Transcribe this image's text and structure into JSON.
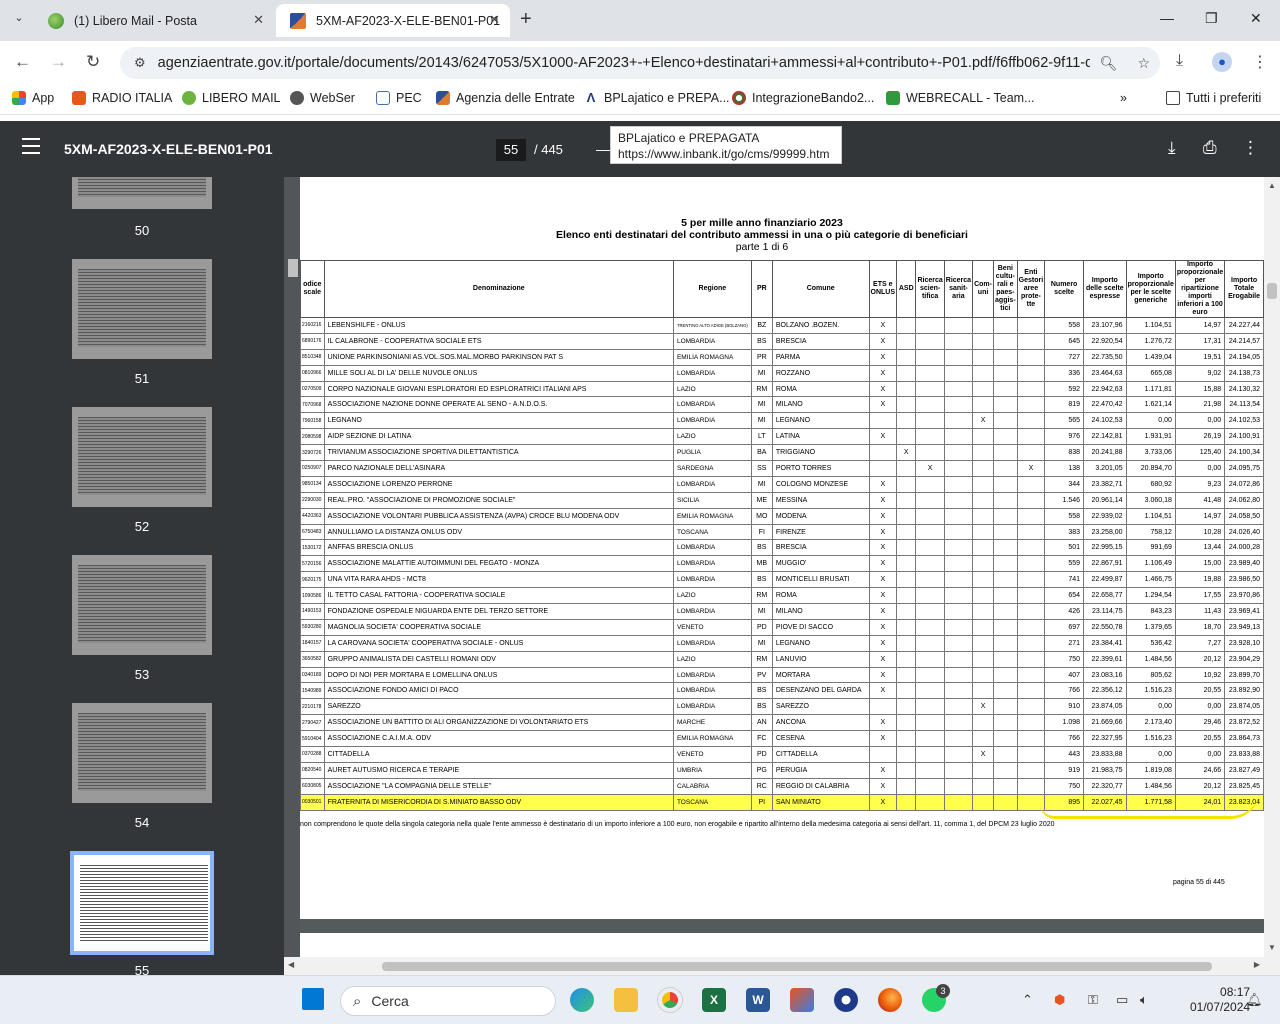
{
  "tabs": [
    {
      "label": "(1) Libero Mail - Posta"
    },
    {
      "label": "5XM-AF2023-X-ELE-BEN01-P01"
    }
  ],
  "url": "agenziaentrate.gov.it/portale/documents/20143/6247053/5X1000-AF2023+-+Elenco+destinatari+ammessi+al+contributo+-P01.pdf/f6ffb062-9f11-d...",
  "bookmarks": [
    {
      "label": "App"
    },
    {
      "label": "RADIO ITALIA"
    },
    {
      "label": "LIBERO MAIL"
    },
    {
      "label": "WebSer"
    },
    {
      "label": "PEC"
    },
    {
      "label": "Agenzia delle Entrate"
    },
    {
      "label": "BPLajatico e PREPA..."
    },
    {
      "label": "IntegrazioneBando2..."
    },
    {
      "label": "WEBRECALL - Team..."
    },
    {
      "label": "Tutti i preferiti"
    }
  ],
  "tooltip": {
    "title": "BPLajatico e PREPAGATA",
    "url": "https://www.inbank.it/go/cms/99999.htm"
  },
  "pdf": {
    "title": "5XM-AF2023-X-ELE-BEN01-P01",
    "page": "55",
    "total": "/ 445"
  },
  "thumbs": [
    "50",
    "51",
    "52",
    "53",
    "54",
    "55"
  ],
  "doc": {
    "title1": "5 per mille anno finanziario 2023",
    "title2": "Elenco enti destinatari del contributo ammessi in una o più categorie di beneficiari",
    "part": "parte 1 di 6",
    "headers": [
      "odice scale",
      "Denominazione",
      "Regione",
      "PR",
      "Comune",
      "ETS e ONLUS",
      "ASD",
      "Ricerca scien-tifica",
      "Ricerca sanit-aria",
      "Com-uni",
      "Beni cultu-rali e paes-aggis-tici",
      "Enti Gestori aree prote-tte",
      "Numero scelte",
      "Importo delle scelte espresse",
      "Importo proporzionale per le scelte generiche",
      "Importo proporzionale per ripartizione importi inferiori a 100 euro",
      "Importo Totale Erogabile"
    ],
    "rows": [
      [
        "2160216",
        "LEBENSHILFE - ONLUS",
        "TRENTINO ALTO ADIGE (BOLZANO)",
        "BZ",
        "BOLZANO .BOZEN.",
        "X",
        "",
        "",
        "",
        "",
        "",
        "",
        "558",
        "23.107,96",
        "1.104,51",
        "14,97",
        "24.227,44"
      ],
      [
        "6890176",
        "IL CALABRONE - COOPERATIVA SOCIALE ETS",
        "LOMBARDIA",
        "BS",
        "BRESCIA",
        "X",
        "",
        "",
        "",
        "",
        "",
        "",
        "645",
        "22.920,54",
        "1.276,72",
        "17,31",
        "24.214,57"
      ],
      [
        "8510348",
        "UNIONE PARKINSONIANI AS.VOL.SOS.MAL.MORBO PARKINSON PAT S",
        "EMILIA ROMAGNA",
        "PR",
        "PARMA",
        "X",
        "",
        "",
        "",
        "",
        "",
        "",
        "727",
        "22.735,50",
        "1.439,04",
        "19,51",
        "24.194,05"
      ],
      [
        "0810966",
        "MILLE SOLI AL DI LA' DELLE NUVOLE ONLUS",
        "LOMBARDIA",
        "MI",
        "ROZZANO",
        "X",
        "",
        "",
        "",
        "",
        "",
        "",
        "336",
        "23.464,63",
        "665,08",
        "9,02",
        "24.138,73"
      ],
      [
        "0270509",
        "CORPO NAZIONALE GIOVANI ESPLORATORI ED ESPLORATRICI ITALIANI APS",
        "LAZIO",
        "RM",
        "ROMA",
        "X",
        "",
        "",
        "",
        "",
        "",
        "",
        "592",
        "22.942,63",
        "1.171,81",
        "15,88",
        "24.130,32"
      ],
      [
        "7070968",
        "ASSOCIAZIONE NAZIONE DONNE OPERATE AL SENO - A.N.D.O.S.",
        "LOMBARDIA",
        "MI",
        "MILANO",
        "X",
        "",
        "",
        "",
        "",
        "",
        "",
        "819",
        "22.470,42",
        "1.621,14",
        "21,98",
        "24.113,54"
      ],
      [
        "7960158",
        "LEGNANO",
        "LOMBARDIA",
        "MI",
        "LEGNANO",
        "",
        "",
        "",
        "",
        "X",
        "",
        "",
        "565",
        "24.102,53",
        "0,00",
        "0,00",
        "24.102,53"
      ],
      [
        "2080598",
        "AIDP SEZIONE DI LATINA",
        "LAZIO",
        "LT",
        "LATINA",
        "X",
        "",
        "",
        "",
        "",
        "",
        "",
        "976",
        "22.142,81",
        "1.931,91",
        "26,19",
        "24.100,91"
      ],
      [
        "3290726",
        "TRIVIANUM ASSOCIAZIONE SPORTIVA DILETTANTISTICA",
        "PUGLIA",
        "BA",
        "TRIGGIANO",
        "",
        "X",
        "",
        "",
        "",
        "",
        "",
        "838",
        "20.241,88",
        "3.733,06",
        "125,40",
        "24.100,34"
      ],
      [
        "0250907",
        "PARCO NAZIONALE DELL'ASINARA",
        "SARDEGNA",
        "SS",
        "PORTO TORRES",
        "",
        "",
        "X",
        "",
        "",
        "",
        "X",
        "138",
        "3.201,05",
        "20.894,70",
        "0,00",
        "24.095,75"
      ],
      [
        "9850134",
        "ASSOCIAZIONE LORENZO PERRONE",
        "LOMBARDIA",
        "MI",
        "COLOGNO MONZESE",
        "X",
        "",
        "",
        "",
        "",
        "",
        "",
        "344",
        "23.382,71",
        "680,92",
        "9,23",
        "24.072,86"
      ],
      [
        "2290030",
        "REAL.PRO. \"ASSOCIAZIONE DI PROMOZIONE SOCIALE\"",
        "SICILIA",
        "ME",
        "MESSINA",
        "X",
        "",
        "",
        "",
        "",
        "",
        "",
        "1.546",
        "20.961,14",
        "3.060,18",
        "41,48",
        "24.062,80"
      ],
      [
        "4420363",
        "ASSOCIAZIONE VOLONTARI PUBBLICA ASSISTENZA (AVPA) CROCE BLU MODENA ODV",
        "EMILIA ROMAGNA",
        "MO",
        "MODENA",
        "X",
        "",
        "",
        "",
        "",
        "",
        "",
        "558",
        "22.939,02",
        "1.104,51",
        "14,97",
        "24.058,50"
      ],
      [
        "6750483",
        "ANNULLIAMO LA DISTANZA ONLUS ODV",
        "TOSCANA",
        "FI",
        "FIRENZE",
        "X",
        "",
        "",
        "",
        "",
        "",
        "",
        "383",
        "23.258,00",
        "758,12",
        "10,28",
        "24.026,40"
      ],
      [
        "1530172",
        "ANFFAS BRESCIA ONLUS",
        "LOMBARDIA",
        "BS",
        "BRESCIA",
        "X",
        "",
        "",
        "",
        "",
        "",
        "",
        "501",
        "22.995,15",
        "991,69",
        "13,44",
        "24.000,28"
      ],
      [
        "5720156",
        "ASSOCIAZIONE MALATTIE AUTOIMMUNI DEL FEGATO - MONZA",
        "LOMBARDIA",
        "MB",
        "MUGGIO'",
        "X",
        "",
        "",
        "",
        "",
        "",
        "",
        "559",
        "22.867,91",
        "1.106,49",
        "15,00",
        "23.989,40"
      ],
      [
        "9620175",
        "UNA VITA RARA AHDS - MCT8",
        "LOMBARDIA",
        "BS",
        "MONTICELLI BRUSATI",
        "X",
        "",
        "",
        "",
        "",
        "",
        "",
        "741",
        "22.499,87",
        "1.466,75",
        "19,88",
        "23.986,50"
      ],
      [
        "1090586",
        "IL TETTO CASAL FATTORIA - COOPERATIVA SOCIALE",
        "LAZIO",
        "RM",
        "ROMA",
        "X",
        "",
        "",
        "",
        "",
        "",
        "",
        "654",
        "22.658,77",
        "1.294,54",
        "17,55",
        "23.970,86"
      ],
      [
        "1490153",
        "FONDAZIONE OSPEDALE NIGUARDA ENTE DEL TERZO SETTORE",
        "LOMBARDIA",
        "MI",
        "MILANO",
        "X",
        "",
        "",
        "",
        "",
        "",
        "",
        "426",
        "23.114,75",
        "843,23",
        "11,43",
        "23.969,41"
      ],
      [
        "5930280",
        "MAGNOLIA SOCIETA' COOPERATIVA SOCIALE",
        "VENETO",
        "PD",
        "PIOVE DI SACCO",
        "X",
        "",
        "",
        "",
        "",
        "",
        "",
        "697",
        "22.550,78",
        "1.379,65",
        "18,70",
        "23.949,13"
      ],
      [
        "1840157",
        "LA CAROVANA SOCIETA' COOPERATIVA SOCIALE - ONLUS",
        "LOMBARDIA",
        "MI",
        "LEGNANO",
        "X",
        "",
        "",
        "",
        "",
        "",
        "",
        "271",
        "23.384,41",
        "536,42",
        "7,27",
        "23.928,10"
      ],
      [
        "3650582",
        "GRUPPO ANIMALISTA DEI CASTELLI ROMANI ODV",
        "LAZIO",
        "RM",
        "LANUVIO",
        "X",
        "",
        "",
        "",
        "",
        "",
        "",
        "750",
        "22.399,61",
        "1.484,56",
        "20,12",
        "23.904,29"
      ],
      [
        "0340189",
        "DOPO DI NOI PER MORTARA E LOMELLINA ONLUS",
        "LOMBARDIA",
        "PV",
        "MORTARA",
        "X",
        "",
        "",
        "",
        "",
        "",
        "",
        "407",
        "23.083,16",
        "805,62",
        "10,92",
        "23.899,70"
      ],
      [
        "1540989",
        "ASSOCIAZIONE FONDO AMICI DI PACO",
        "LOMBARDIA",
        "BS",
        "DESENZANO DEL GARDA",
        "X",
        "",
        "",
        "",
        "",
        "",
        "",
        "766",
        "22.356,12",
        "1.516,23",
        "20,55",
        "23.892,90"
      ],
      [
        "2210178",
        "SAREZZO",
        "LOMBARDIA",
        "BS",
        "SAREZZO",
        "",
        "",
        "",
        "",
        "X",
        "",
        "",
        "910",
        "23.874,05",
        "0,00",
        "0,00",
        "23.874,05"
      ],
      [
        "2790427",
        "ASSOCIAZIONE UN BATTITO DI ALI ORGANIZZAZIONE DI VOLONTARIATO ETS",
        "MARCHE",
        "AN",
        "ANCONA",
        "X",
        "",
        "",
        "",
        "",
        "",
        "",
        "1.098",
        "21.669,66",
        "2.173,40",
        "29,46",
        "23.872,52"
      ],
      [
        "5910404",
        "ASSOCIAZIONE C.A.I.M.A. ODV",
        "EMILIA ROMAGNA",
        "FC",
        "CESENA",
        "X",
        "",
        "",
        "",
        "",
        "",
        "",
        "766",
        "22.327,95",
        "1.516,23",
        "20,55",
        "23.864,73"
      ],
      [
        "0370288",
        "CITTADELLA",
        "VENETO",
        "PD",
        "CITTADELLA",
        "",
        "",
        "",
        "",
        "X",
        "",
        "",
        "443",
        "23.833,88",
        "0,00",
        "0,00",
        "23.833,88"
      ],
      [
        "0820540",
        "AURET AUTUSMO RICERCA E TERAPIE",
        "UMBRIA",
        "PG",
        "PERUGIA",
        "X",
        "",
        "",
        "",
        "",
        "",
        "",
        "919",
        "21.983,75",
        "1.819,08",
        "24,66",
        "23.827,49"
      ],
      [
        "6030805",
        "ASSOCIAZIONE \"LA COMPAGNIA DELLE STELLE\"",
        "CALABRIA",
        "RC",
        "REGGIO DI CALABRIA",
        "X",
        "",
        "",
        "",
        "",
        "",
        "",
        "750",
        "22.320,77",
        "1.484,56",
        "20,12",
        "23.825,45"
      ],
      [
        "0030501",
        "FRATERNITA DI MISERICORDIA DI S.MINIATO BASSO ODV",
        "TOSCANA",
        "PI",
        "SAN MINIATO",
        "X",
        "",
        "",
        "",
        "",
        "",
        "",
        "895",
        "22.027,45",
        "1.771,58",
        "24,01",
        "23.823,04"
      ]
    ],
    "footnote": "non comprendono le quote della singola categoria nella quale l'ente ammesso è destinatario di un importo inferiore a 100 euro, non erogabile e ripartito all'interno della medesima categoria ai sensi dell'art. 11, comma 1, del DPCM 23 luglio 2020",
    "pagenum": "pagina 55 di 445"
  },
  "taskbar": {
    "search": "Cerca",
    "time": "08:17",
    "date": "01/07/2024",
    "whatsapp_badge": "3"
  }
}
